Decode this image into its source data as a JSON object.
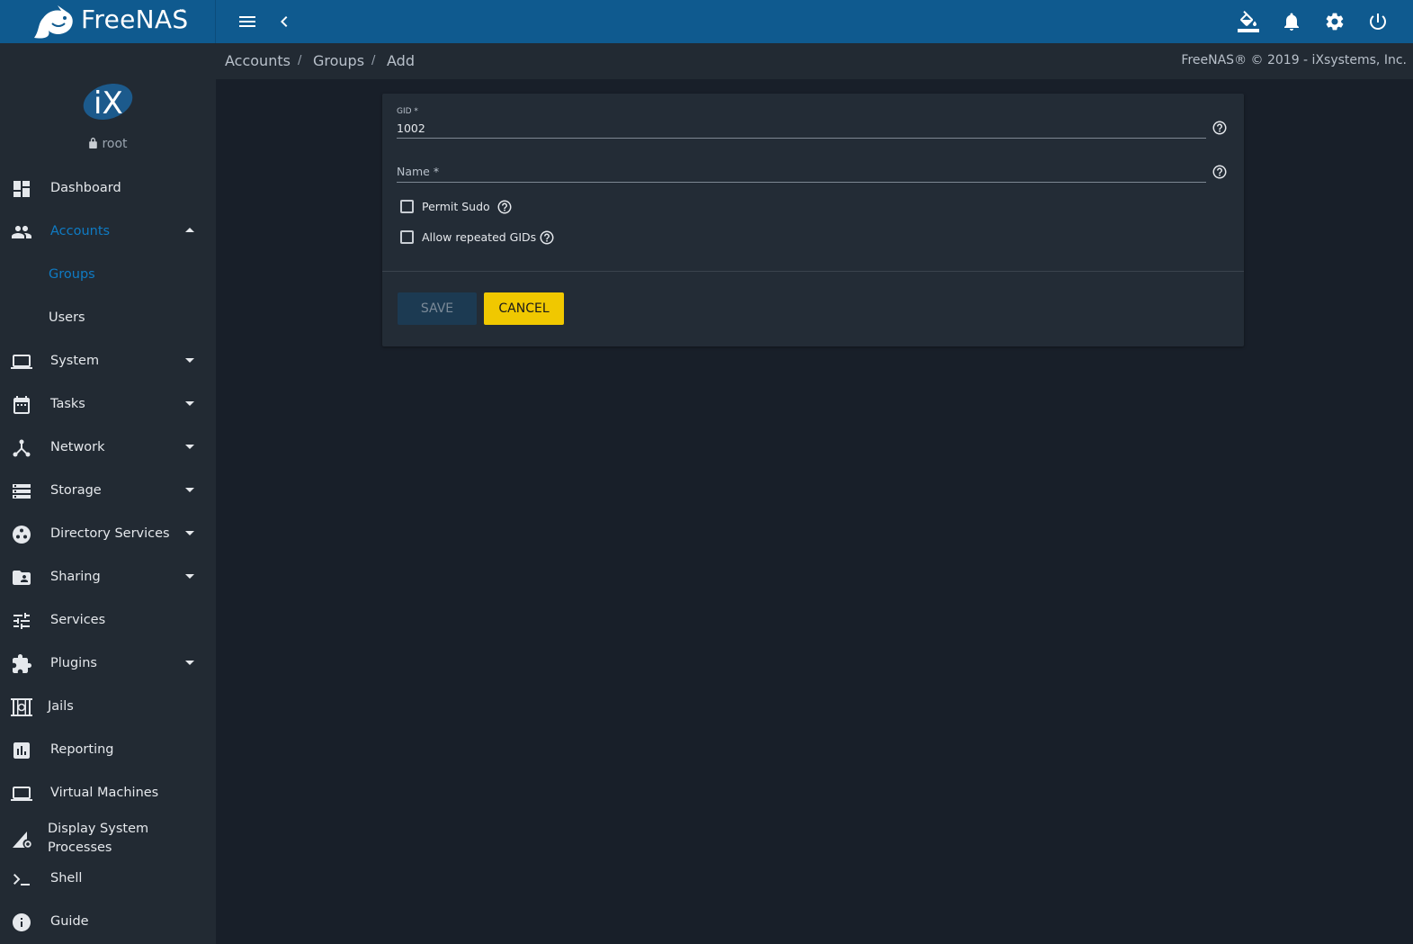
{
  "topbar": {
    "brand_text": "FreeNAS",
    "brand_tm": "™",
    "icons": [
      "menu-icon",
      "chevron-left-icon",
      "theme-paint-bucket-icon",
      "notifications-bell-icon",
      "settings-gear-icon",
      "power-icon"
    ],
    "brand_color": "#0f5a8f"
  },
  "profile": {
    "username": "root"
  },
  "sidebar": {
    "items": [
      {
        "label": "Dashboard",
        "icon": "dashboard-icon"
      },
      {
        "label": "Accounts",
        "icon": "people-icon",
        "expanded": true
      },
      {
        "label": "Groups",
        "sub": true,
        "active": true
      },
      {
        "label": "Users",
        "sub": true
      },
      {
        "label": "System",
        "icon": "laptop-icon"
      },
      {
        "label": "Tasks",
        "icon": "calendar-icon"
      },
      {
        "label": "Network",
        "icon": "network-icon"
      },
      {
        "label": "Storage",
        "icon": "storage-icon"
      },
      {
        "label": "Directory Services",
        "icon": "directory-icon"
      },
      {
        "label": "Sharing",
        "icon": "shared-folder-icon"
      },
      {
        "label": "Services",
        "icon": "tune-icon"
      },
      {
        "label": "Plugins",
        "icon": "puzzle-icon"
      },
      {
        "label": "Jails",
        "icon": "jail-icon"
      },
      {
        "label": "Reporting",
        "icon": "bar-chart-icon"
      },
      {
        "label": "Virtual Machines",
        "icon": "laptop-icon"
      },
      {
        "label": "Display System Processes",
        "icon": "system-processes-icon"
      },
      {
        "label": "Shell",
        "icon": "console-icon"
      },
      {
        "label": "Guide",
        "icon": "info-icon"
      }
    ],
    "active_color": "#0f7bc4"
  },
  "breadcrumb": {
    "items": [
      "Accounts",
      "Groups",
      "Add"
    ],
    "separator": "/"
  },
  "copyright": "FreeNAS® © 2019 - iXsystems, Inc.",
  "form": {
    "gid_label": "GID *",
    "gid_value": "1002",
    "name_label": "Name *",
    "permit_sudo_label": "Permit Sudo",
    "allow_repeated_gids_label": "Allow repeated GIDs",
    "save_label": "SAVE",
    "cancel_label": "CANCEL",
    "cancel_color": "#f0c800"
  }
}
